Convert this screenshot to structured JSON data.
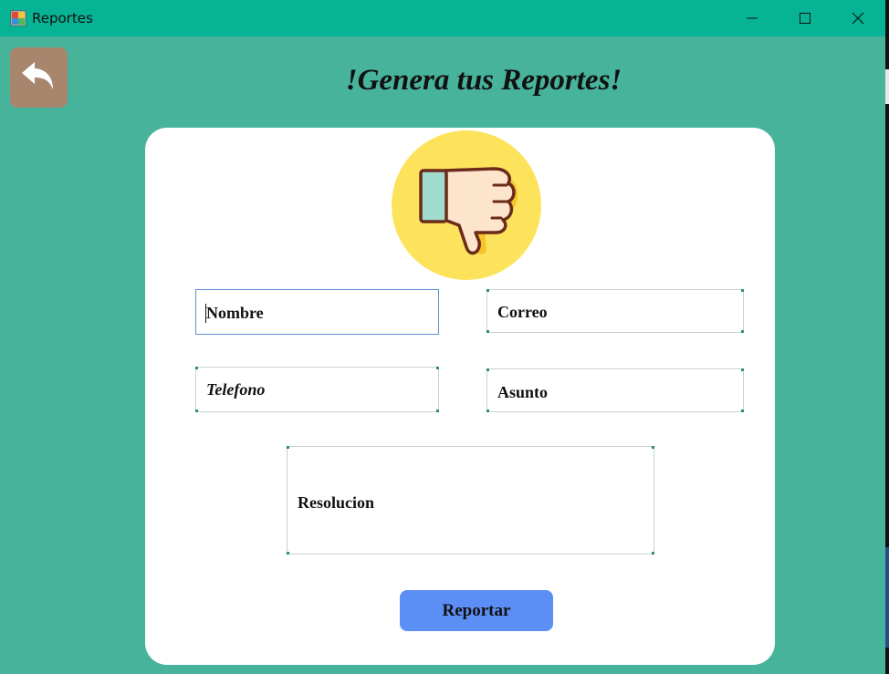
{
  "window": {
    "title": "Reportes",
    "app_icon": "windows-form-icon",
    "controls": [
      "minimize-icon",
      "maximize-icon",
      "close-icon"
    ]
  },
  "header": {
    "back_icon": "back-arrow-icon",
    "heading": "!Genera tus Reportes!"
  },
  "form": {
    "emblem_icon": "thumbs-down-icon",
    "nombre": "Nombre",
    "correo": "Correo",
    "telefono": "Telefono",
    "asunto": "Asunto",
    "resolucion": "Resolucion",
    "submit_label": "Reportar"
  },
  "colors": {
    "background": "#48b39b",
    "titlebar": "#06b394",
    "back_button": "#a8866e",
    "submit_button": "#5b8ff5",
    "emblem_circle": "#fde35c"
  }
}
